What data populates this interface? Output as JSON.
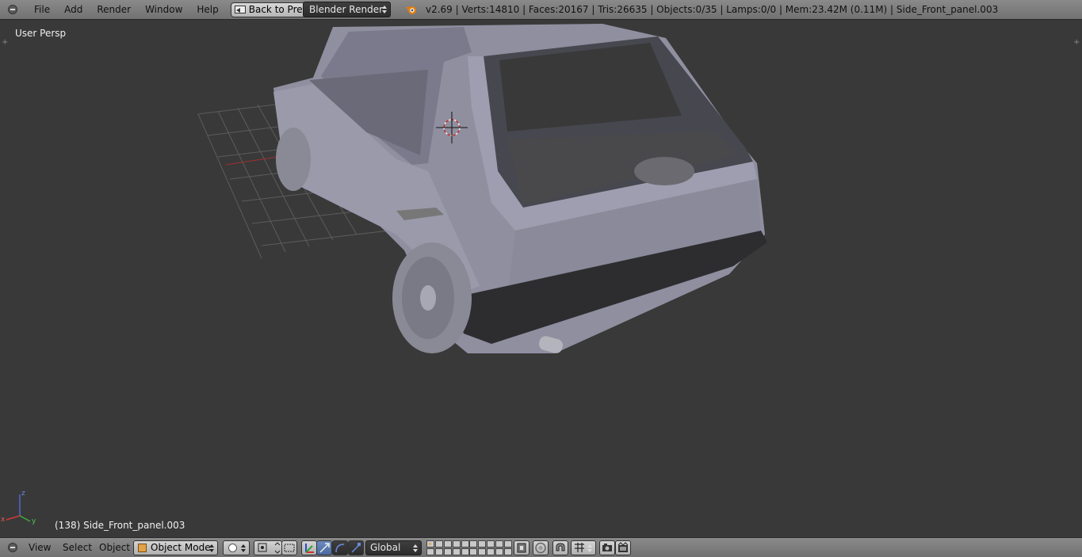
{
  "top_header": {
    "menu": [
      "File",
      "Add",
      "Render",
      "Window",
      "Help"
    ],
    "back_label": "Back to Previous",
    "render_engine": "Blender Render",
    "stats": "v2.69 | Verts:14810 | Faces:20167 | Tris:26635 | Objects:0/35 | Lamps:0/0 | Mem:23.42M (0.11M) | Side_Front_panel.003"
  },
  "viewport": {
    "view_label": "User Persp",
    "object_label": "(138) Side_Front_panel.003",
    "axes": {
      "x": "x",
      "y": "y",
      "z": "z"
    }
  },
  "bottom_header": {
    "menu": [
      "View",
      "Select",
      "Object"
    ],
    "mode": "Object Mode",
    "orientation": "Global"
  },
  "icons": {
    "editor_type": "editor-menu-icon",
    "back": "back-to-previous-icon",
    "blender": "blender-logo-icon",
    "mode": "object-mode-cube-icon",
    "shading": "solid-shading-icon",
    "pivot": "pivot-point-icon",
    "manipulator_toggle": "manipulator-icon",
    "translate": "translate-icon",
    "rotate": "rotate-icon",
    "scale": "scale-icon",
    "layers": "layer-grid-icon",
    "lock_layers": "lock-layers-icon",
    "proportional": "proportional-editing-icon",
    "snap": "snap-magnet-icon",
    "snap_element": "snap-element-icon",
    "render_still": "render-still-icon",
    "render_anim": "render-animation-icon"
  },
  "colors": {
    "header_bg": "#7e7e7e",
    "viewport_bg": "#393939",
    "accent_blue": "#5578b4",
    "grid_line": "#5a5a5a",
    "axis_x": "#b23030",
    "axis_y": "#3a9a3a",
    "model": "#a0a0b0"
  }
}
